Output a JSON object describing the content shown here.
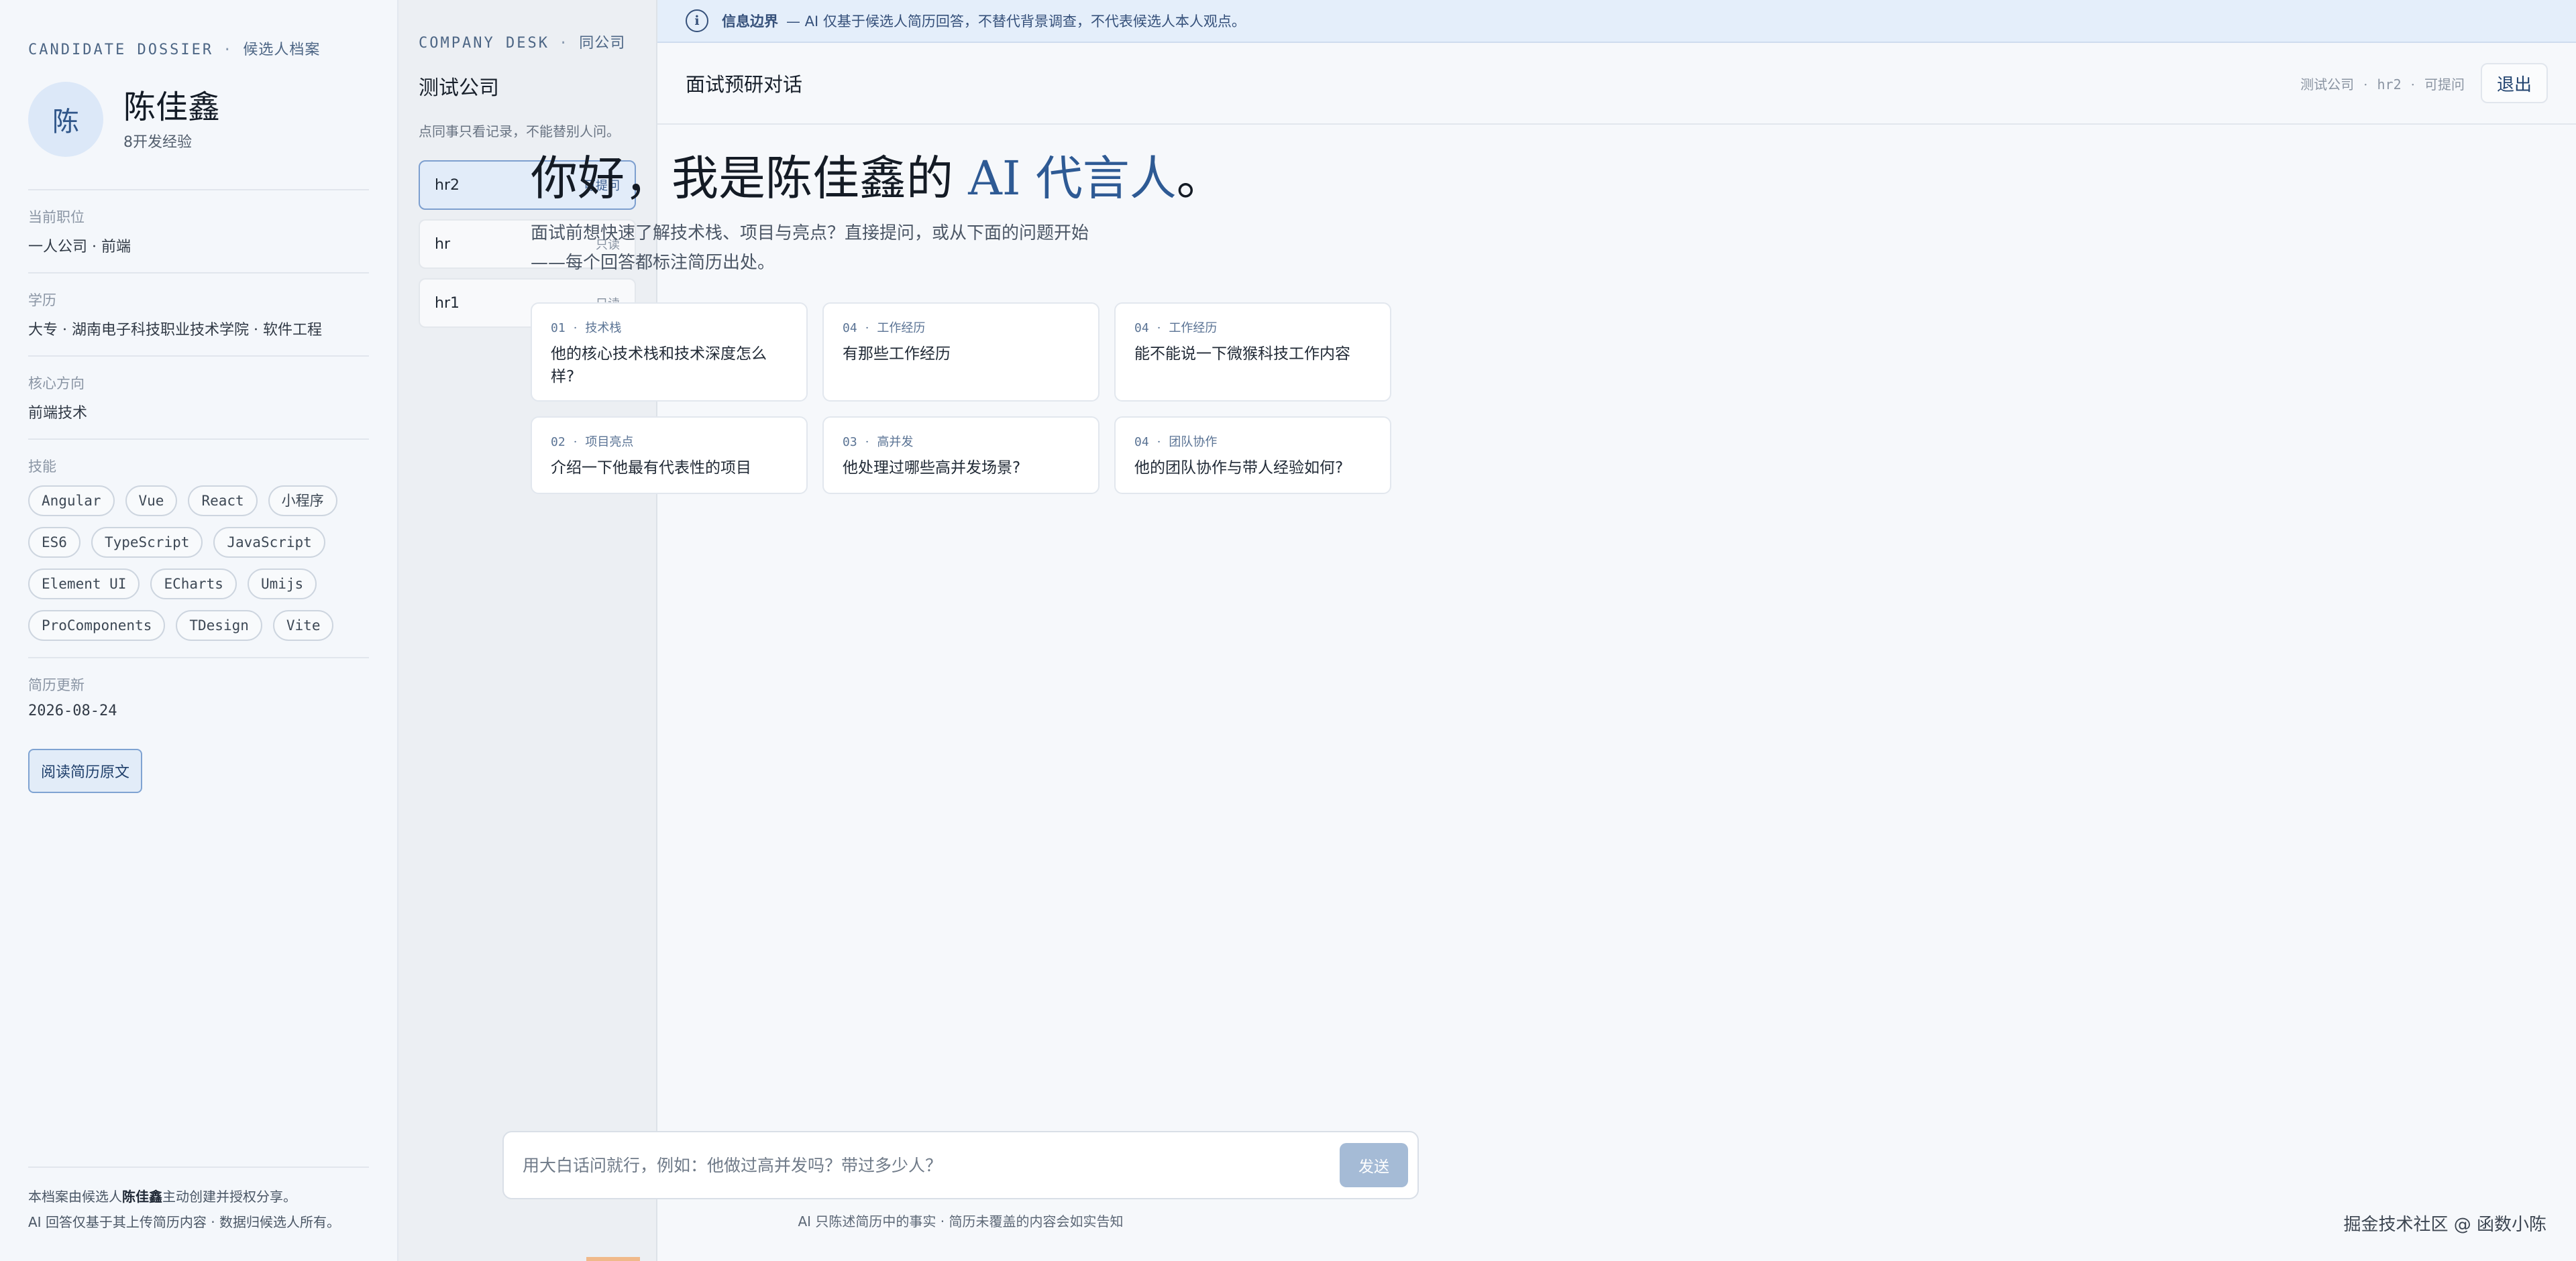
{
  "dossier": {
    "eyebrow_en": "CANDIDATE DOSSIER",
    "eyebrow_sep": "·",
    "eyebrow_cn": "候选人档案",
    "avatar_initial": "陈",
    "name": "陈佳鑫",
    "experience": "8开发经验",
    "fields": {
      "position": {
        "label": "当前职位",
        "value": "一人公司 · 前端"
      },
      "education": {
        "label": "学历",
        "value": "大专 · 湖南电子科技职业技术学院 · 软件工程"
      },
      "focus": {
        "label": "核心方向",
        "value": "前端技术"
      },
      "skills_label": "技能",
      "updated": {
        "label": "简历更新",
        "value": "2026-08-24"
      }
    },
    "skills": [
      "Angular",
      "Vue",
      "React",
      "小程序",
      "ES6",
      "TypeScript",
      "JavaScript",
      "Element UI",
      "ECharts",
      "Umijs",
      "ProComponents",
      "TDesign",
      "Vite"
    ],
    "read_resume_label": "阅读简历原文",
    "footer": {
      "line1_prefix": "本档案由候选人",
      "line1_name": "陈佳鑫",
      "line1_suffix": "主动创建并授权分享。",
      "line2": "AI 回答仅基于其上传简历内容 · 数据归候选人所有。"
    }
  },
  "desk": {
    "eyebrow_en": "COMPANY DESK",
    "eyebrow_sep": "·",
    "eyebrow_cn": "同公司",
    "company": "测试公司",
    "note": "点同事只看记录，不能替别人问。",
    "users": [
      {
        "name": "hr2",
        "permission": "可提问",
        "active": true
      },
      {
        "name": "hr",
        "permission": "只读",
        "active": false
      },
      {
        "name": "hr1",
        "permission": "只读",
        "active": false
      }
    ]
  },
  "banner": {
    "title": "信息边界",
    "text": "— AI 仅基于候选人简历回答，不替代背景调查，不代表候选人本人观点。"
  },
  "topbar": {
    "title": "面试预研对话",
    "meta_company": "测试公司",
    "meta_user": "hr2",
    "meta_role": "可提问",
    "meta_sep": "·",
    "logout_label": "退出"
  },
  "hero": {
    "greeting_prefix": "你好，我是陈佳鑫的 ",
    "greeting_accent": "AI 代言人",
    "greeting_suffix": "。",
    "intro_line1": "面试前想快速了解技术栈、项目与亮点？直接提问，或从下面的问题开始",
    "intro_line2": "——每个回答都标注简历出处。"
  },
  "suggestions": [
    {
      "num": "01",
      "category": "技术栈",
      "question": "他的核心技术栈和技术深度怎么样?"
    },
    {
      "num": "04",
      "category": "工作经历",
      "question": "有那些工作经历"
    },
    {
      "num": "04",
      "category": "工作经历",
      "question": "能不能说一下微猴科技工作内容"
    },
    {
      "num": "02",
      "category": "项目亮点",
      "question": "介绍一下他最有代表性的项目"
    },
    {
      "num": "03",
      "category": "高并发",
      "question": "他处理过哪些高并发场景?"
    },
    {
      "num": "04",
      "category": "团队协作",
      "question": "他的团队协作与带人经验如何?"
    }
  ],
  "composer": {
    "placeholder": "用大白话问就行，例如：他做过高并发吗？带过多少人？",
    "value": "",
    "send_label": "发送"
  },
  "disclaimer": "AI 只陈述简历中的事实 · 简历未覆盖的内容会如实告知",
  "watermark": "掘金技术社区 @ 函数小陈",
  "colors": {
    "accent": "#2e5a94",
    "banner_bg": "#e4eefa",
    "active_item_bg": "#e2ecf9",
    "send_button": "#a5bbd6"
  }
}
